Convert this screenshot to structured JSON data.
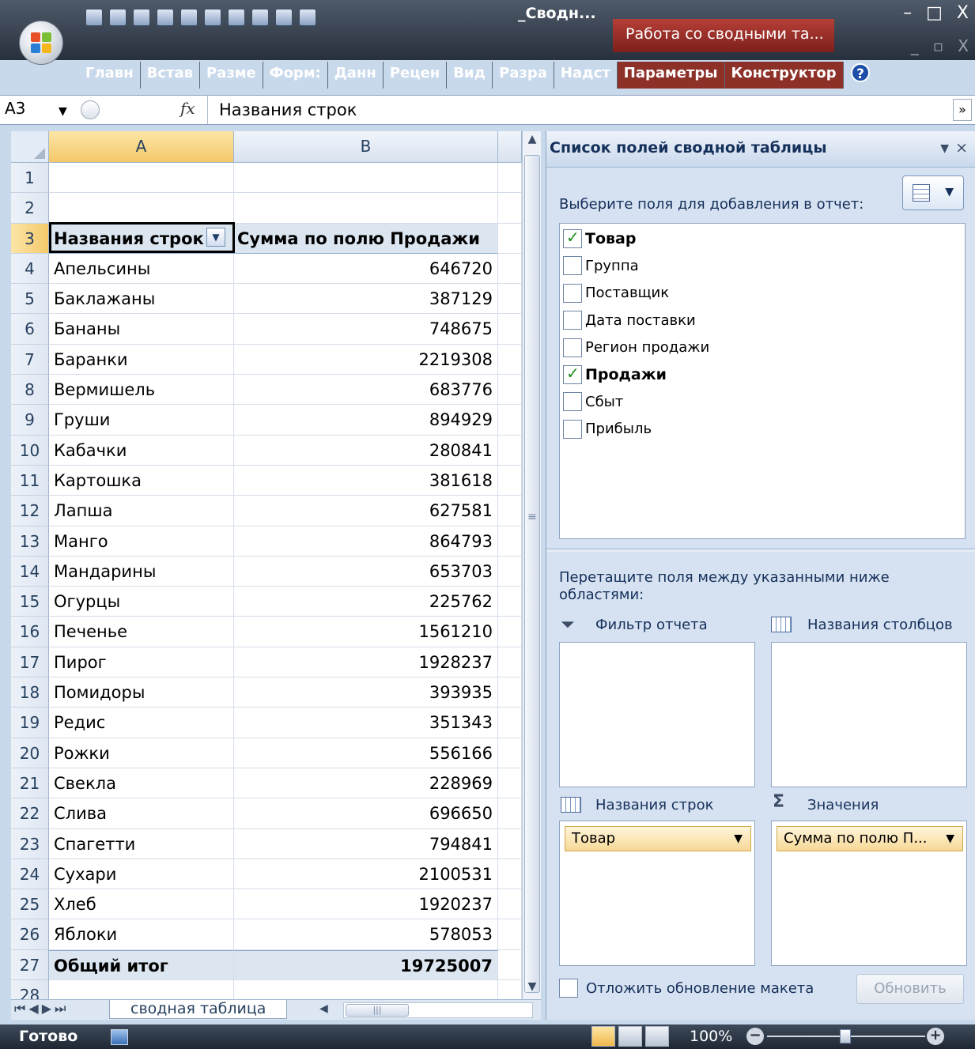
{
  "window": {
    "title": "_Сводн...",
    "context_tab_title": "Работа со сводными та...",
    "controls": [
      "–",
      "□",
      "X"
    ],
    "doc_controls": [
      "_",
      "▫",
      "X"
    ]
  },
  "ribbon": {
    "tabs": [
      "Главн",
      "Встав",
      "Разме",
      "Форм:",
      "Данн",
      "Рецен",
      "Вид",
      "Разра",
      "Надст",
      "Параметры",
      "Конструктор"
    ],
    "context_tabs": [
      "Параметры",
      "Конструктор"
    ]
  },
  "formula_bar": {
    "name_box": "A3",
    "fx": "fx",
    "content": "Названия строк"
  },
  "sheet": {
    "columns": [
      "A",
      "B"
    ],
    "rows": [
      {
        "n": "1",
        "a": "",
        "b": ""
      },
      {
        "n": "2",
        "a": "",
        "b": ""
      },
      {
        "n": "3",
        "a": "Названия строк",
        "b": "Сумма по полю Продажи"
      },
      {
        "n": "4",
        "a": "Апельсины",
        "b": "646720"
      },
      {
        "n": "5",
        "a": "Баклажаны",
        "b": "387129"
      },
      {
        "n": "6",
        "a": "Бананы",
        "b": "748675"
      },
      {
        "n": "7",
        "a": "Баранки",
        "b": "2219308"
      },
      {
        "n": "8",
        "a": "Вермишель",
        "b": "683776"
      },
      {
        "n": "9",
        "a": "Груши",
        "b": "894929"
      },
      {
        "n": "10",
        "a": "Кабачки",
        "b": "280841"
      },
      {
        "n": "11",
        "a": "Картошка",
        "b": "381618"
      },
      {
        "n": "12",
        "a": "Лапша",
        "b": "627581"
      },
      {
        "n": "13",
        "a": "Манго",
        "b": "864793"
      },
      {
        "n": "14",
        "a": "Мандарины",
        "b": "653703"
      },
      {
        "n": "15",
        "a": "Огурцы",
        "b": "225762"
      },
      {
        "n": "16",
        "a": "Печенье",
        "b": "1561210"
      },
      {
        "n": "17",
        "a": "Пирог",
        "b": "1928237"
      },
      {
        "n": "18",
        "a": "Помидоры",
        "b": "393935"
      },
      {
        "n": "19",
        "a": "Редис",
        "b": "351343"
      },
      {
        "n": "20",
        "a": "Рожки",
        "b": "556166"
      },
      {
        "n": "21",
        "a": "Свекла",
        "b": "228969"
      },
      {
        "n": "22",
        "a": "Слива",
        "b": "696650"
      },
      {
        "n": "23",
        "a": "Спагетти",
        "b": "794841"
      },
      {
        "n": "24",
        "a": "Сухари",
        "b": "2100531"
      },
      {
        "n": "25",
        "a": "Хлеб",
        "b": "1920237"
      },
      {
        "n": "26",
        "a": "Яблоки",
        "b": "578053"
      },
      {
        "n": "27",
        "a": "Общий итог",
        "b": "19725007"
      },
      {
        "n": "28",
        "a": "",
        "b": ""
      }
    ],
    "tab_name": "сводная таблица"
  },
  "pivot_pane": {
    "title": "Список полей сводной таблицы",
    "choose_label": "Выберите поля для добавления в отчет:",
    "fields": [
      {
        "label": "Товар",
        "checked": true
      },
      {
        "label": "Группа",
        "checked": false
      },
      {
        "label": "Поставщик",
        "checked": false
      },
      {
        "label": "Дата поставки",
        "checked": false
      },
      {
        "label": "Регион продажи",
        "checked": false
      },
      {
        "label": "Продажи",
        "checked": true
      },
      {
        "label": "Сбыт",
        "checked": false
      },
      {
        "label": "Прибыль",
        "checked": false
      }
    ],
    "drag_label": "Перетащите поля между указанными ниже областями:",
    "areas": {
      "filter": "Фильтр отчета",
      "columns": "Названия столбцов",
      "rows": "Названия строк",
      "values": "Значения",
      "rows_item": "Товар",
      "values_item": "Сумма по полю П..."
    },
    "defer_label": "Отложить обновление макета",
    "update_button": "Обновить"
  },
  "statusbar": {
    "status": "Готово",
    "zoom": "100%"
  },
  "colors": {
    "pivot_header_bg": "#dce6f1",
    "context_tab": "#8d3028",
    "selected_header": "#f5c96a"
  }
}
